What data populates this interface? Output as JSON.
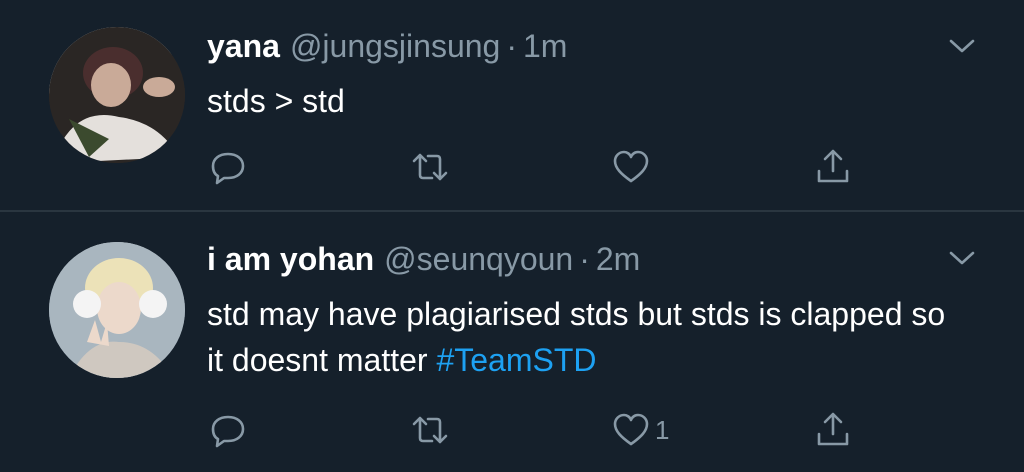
{
  "tweets": [
    {
      "display_name": "yana",
      "handle": "@jungsjinsung",
      "separator": "·",
      "time": "1m",
      "text": "stds > std",
      "hashtag": "",
      "like_count": "",
      "avatar_icon": "avatar-photo"
    },
    {
      "display_name": "i am yohan",
      "handle": "@seunqyoun",
      "separator": "·",
      "time": "2m",
      "text": "std may have plagiarised stds but stds is clapped so it doesnt matter ",
      "hashtag": "#TeamSTD",
      "like_count": "1",
      "avatar_icon": "avatar-photo"
    }
  ],
  "icons": {
    "reply": "reply-icon",
    "retweet": "retweet-icon",
    "like": "heart-icon",
    "share": "share-icon",
    "more": "chevron-down-icon"
  },
  "colors": {
    "background": "#15202b",
    "secondary_text": "#8899a6",
    "link": "#1da1f2",
    "primary_text": "#ffffff"
  }
}
